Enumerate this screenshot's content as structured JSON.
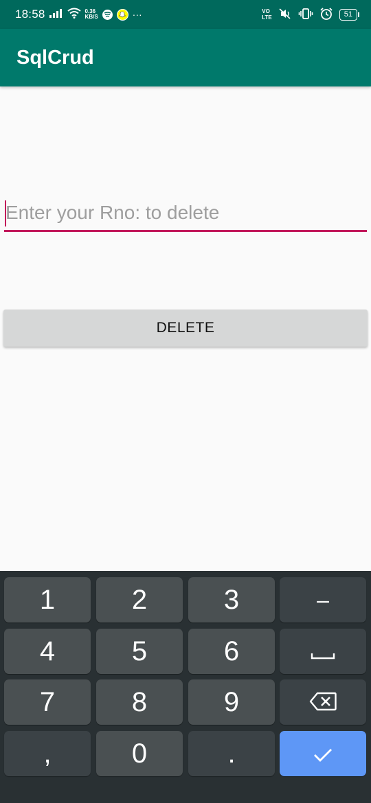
{
  "status_bar": {
    "time": "18:58",
    "net_speed_value": "0.36",
    "net_speed_unit": "KB/S",
    "overflow": "···",
    "volte_top": "VO",
    "volte_bottom": "LTE",
    "battery": "51",
    "icons": [
      "signal-icon",
      "wifi-icon",
      "spotify-icon",
      "snapchat-icon",
      "vibrate-icon",
      "alarm-icon",
      "battery-icon"
    ]
  },
  "toolbar": {
    "title": "SqlCrud",
    "color": "#00796b"
  },
  "form": {
    "rno_placeholder": "Enter your Rno: to delete",
    "rno_value": "",
    "delete_label": "DELETE",
    "accent": "#c2185b"
  },
  "keyboard": {
    "keys": {
      "k1": "1",
      "k2": "2",
      "k3": "3",
      "minus": "–",
      "k4": "4",
      "k5": "5",
      "k6": "6",
      "k7": "7",
      "k8": "8",
      "k9": "9",
      "comma": ",",
      "k0": "0",
      "period": "."
    },
    "special_icons": [
      "space-icon",
      "backspace-icon",
      "checkmark-icon"
    ],
    "done_color": "#5e97f6"
  }
}
